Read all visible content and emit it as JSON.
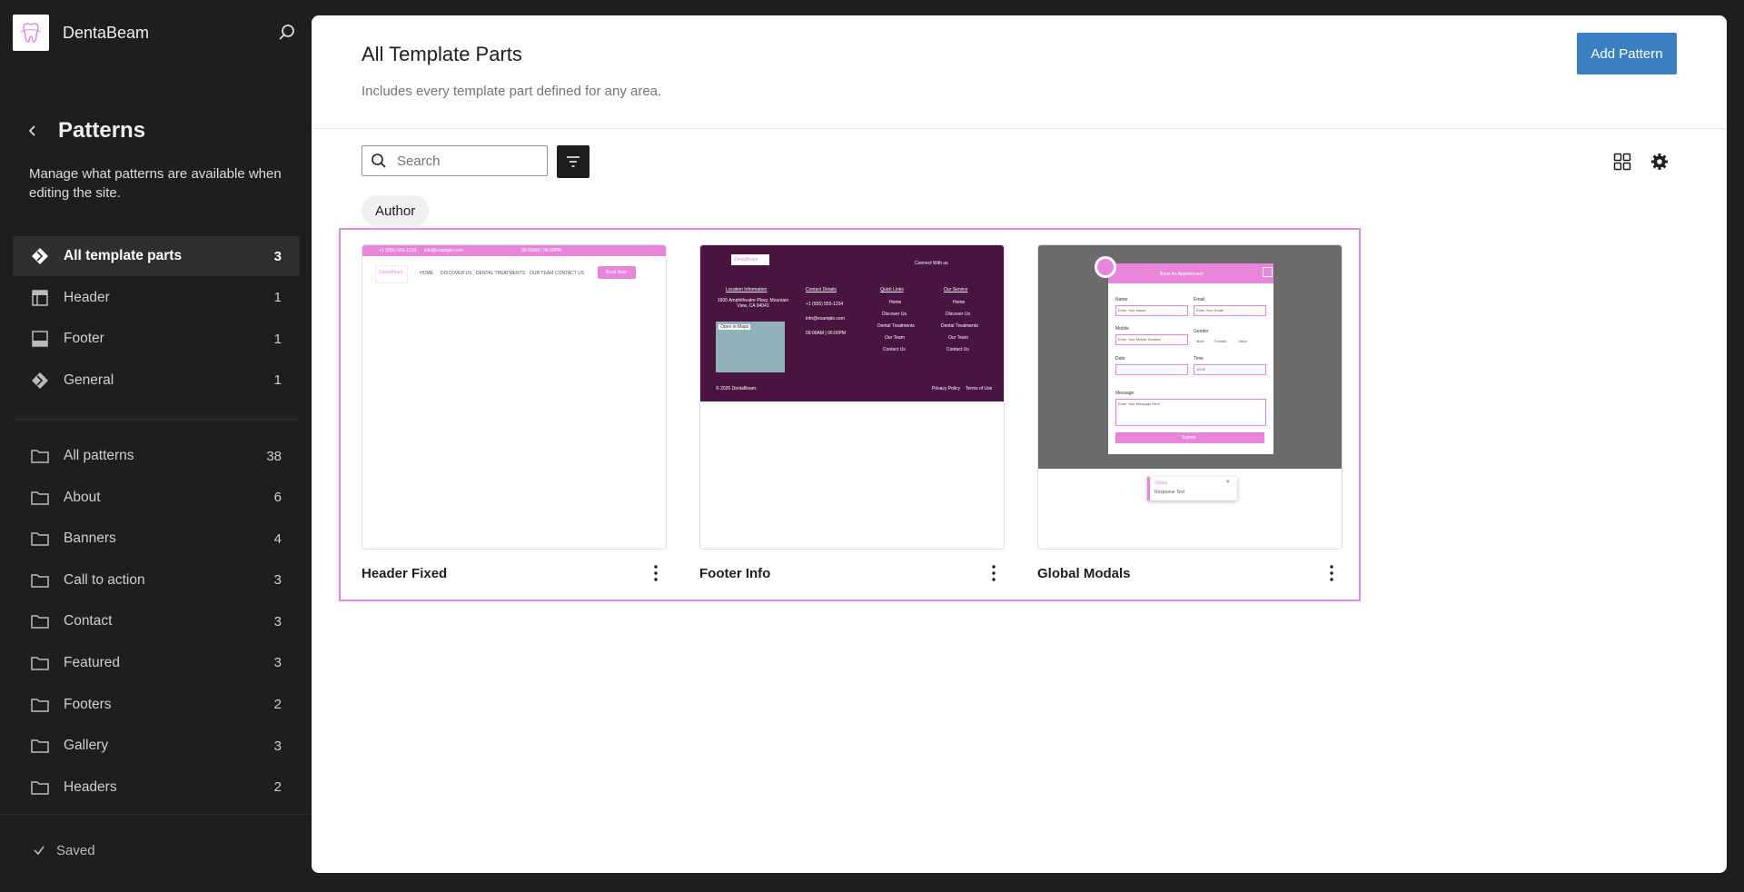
{
  "site": {
    "name": "DentaBeam"
  },
  "sidebar": {
    "title": "Patterns",
    "description": "Manage what patterns are available when editing the site.",
    "template_parts": [
      {
        "label": "All template parts",
        "count": "3",
        "icon": "template-parts-icon",
        "active": true
      },
      {
        "label": "Header",
        "count": "1",
        "icon": "header-icon"
      },
      {
        "label": "Footer",
        "count": "1",
        "icon": "footer-icon"
      },
      {
        "label": "General",
        "count": "1",
        "icon": "template-parts-icon"
      }
    ],
    "categories": [
      {
        "label": "All patterns",
        "count": "38"
      },
      {
        "label": "About",
        "count": "6"
      },
      {
        "label": "Banners",
        "count": "4"
      },
      {
        "label": "Call to action",
        "count": "3"
      },
      {
        "label": "Contact",
        "count": "3"
      },
      {
        "label": "Featured",
        "count": "3"
      },
      {
        "label": "Footers",
        "count": "2"
      },
      {
        "label": "Gallery",
        "count": "3"
      },
      {
        "label": "Headers",
        "count": "2"
      }
    ],
    "saved_label": "Saved"
  },
  "main": {
    "title": "All Template Parts",
    "description": "Includes every template part defined for any area.",
    "add_button": "Add Pattern",
    "search_placeholder": "Search",
    "filter_chip": "Author",
    "accent_color": "#3a7fc1",
    "highlight_color": "#d98ee6"
  },
  "cards": [
    {
      "title": "Header Fixed",
      "preview": {
        "topbar_phone": "+1 (555) 555-1234",
        "topbar_email": "info@example.com",
        "topbar_hours": "09:00AM | 06:00PM",
        "logo": "DentaBeam",
        "nav": [
          "HOME",
          "DISCOVER US",
          "DENTAL TREATMENTS",
          "OUR TEAM",
          "CONTACT US"
        ],
        "cta": "Book Now"
      }
    },
    {
      "title": "Footer Info",
      "preview": {
        "logo": "DentaBeam",
        "connect": "Connect With us",
        "location_title": "Location Information",
        "location_text": "1600 Amphitheatre Pkwy, Mountain View, CA 94043",
        "contact_title": "Contact Details",
        "contact_phone": "+1 (555) 555-1234",
        "contact_email": "info@example.com",
        "contact_hours": "09:00AM | 06:00PM",
        "quick_title": "Quick Links",
        "quick_links": [
          "Home",
          "Discover Us",
          "Dental Treatments",
          "Our Team",
          "Contact Us"
        ],
        "service_title": "Our Service",
        "service_links": [
          "Home",
          "Discover Us",
          "Dental Treatments",
          "Our Team",
          "Contact Us"
        ],
        "copyright": "© 2026 DentaBeam.",
        "privacy": "Privacy Policy",
        "terms": "Terms of Use",
        "map_label": "Open in Maps"
      }
    },
    {
      "title": "Global Modals",
      "preview": {
        "modal_title": "Book An Appointment",
        "name_label": "Name",
        "name_ph": "Enter Your Name",
        "email_label": "Email",
        "email_ph": "Enter Your Email",
        "mobile_label": "Mobile",
        "mobile_ph": "Enter Your Mobile Number",
        "gender_label": "Gender",
        "gender_male": "Male",
        "gender_female": "Female",
        "gender_other": "Other",
        "date_label": "Date",
        "time_label": "Time",
        "time_value": "10:00",
        "message_label": "Message",
        "message_ph": "Enter Your Message Here",
        "submit": "Submit",
        "toast_title": "Status",
        "toast_text": "Response Text"
      }
    }
  ]
}
